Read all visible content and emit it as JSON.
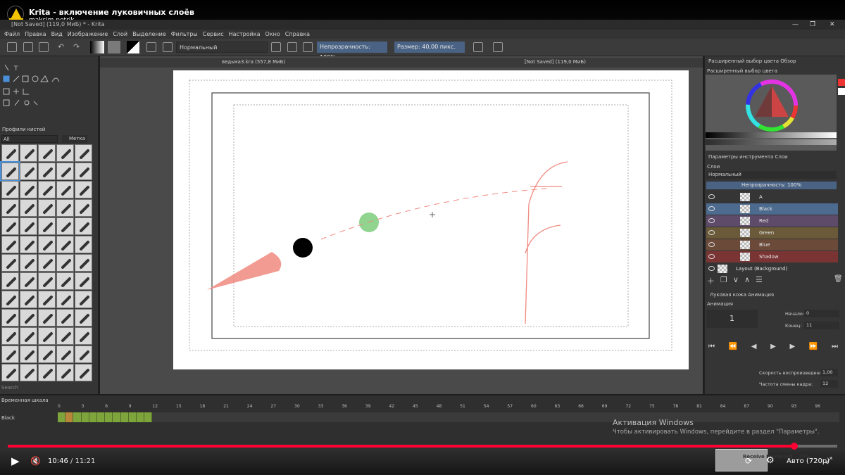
{
  "video": {
    "title": "Krita - включение луковичных слоёв",
    "channel": "maksim petrik",
    "time_current": "10:46",
    "time_total": "11:21",
    "progress": 0.948,
    "quality": "Авто (720p)",
    "end_card": "Receive Keyboard – 30%"
  },
  "krita": {
    "window_title": "[Not Saved]  (119,0 MиБ) * - Krita",
    "menu": [
      "Файл",
      "Правка",
      "Вид",
      "Изображение",
      "Слой",
      "Выделение",
      "Фильтры",
      "Сервис",
      "Настройка",
      "Окно",
      "Справка"
    ],
    "toolbar": {
      "blend_mode": "Нормальный",
      "opacity": "Непрозрачность: 100%",
      "size": "Размер: 40,00 пикс."
    },
    "tabs": [
      "ведьма3.kra (557,8 MиБ)",
      "[Not Saved]  (119,0 MиБ)"
    ],
    "brush_presets": {
      "title": "Профили кистей",
      "filter": "All",
      "tag": "Метка",
      "search": "Search"
    },
    "color": {
      "tabs": "Расширенный выбор цвета     Обзор",
      "title": "Расширенный выбор цвета"
    },
    "layers": {
      "tabs": "Параметры инструмента     Слои",
      "title": "Слои",
      "blend": "Нормальный",
      "opacity": "Непрозрачность: 100%",
      "items": [
        {
          "name": "A",
          "color": "#353535"
        },
        {
          "name": "Black",
          "color": "#4d6b8e"
        },
        {
          "name": "Red",
          "color": "#5e4b69"
        },
        {
          "name": "Green",
          "color": "#6b5a3a"
        },
        {
          "name": "Blue",
          "color": "#6b4a3a"
        },
        {
          "name": "Shadow",
          "color": "#7a3434"
        },
        {
          "name": "Layout (Background)",
          "color": "#353535"
        }
      ]
    },
    "animation": {
      "tabs": "Луковая кожа     Анимация",
      "title": "Анимация",
      "current_frame": "1",
      "start_label": "Начало:",
      "start": "0",
      "end_label": "Конец:",
      "end": "11",
      "speed_label": "Скорость воспроизведения:",
      "speed": "1,00",
      "fps_label": "Частота смены кадра:",
      "fps": "12"
    },
    "timeline": {
      "title": "Временная шкала",
      "layer": "Black",
      "ruler": [
        "0",
        "3",
        "6",
        "9",
        "12",
        "15",
        "18",
        "21",
        "24",
        "27",
        "30",
        "33",
        "36",
        "39",
        "42",
        "45",
        "48",
        "51",
        "54",
        "57",
        "60",
        "63",
        "66",
        "69",
        "72",
        "75",
        "78",
        "81",
        "84",
        "87",
        "90",
        "93",
        "96"
      ],
      "keyframes": 12
    }
  },
  "windows": {
    "activation_title": "Активация Windows",
    "activation_sub": "Чтобы активировать Windows, перейдите в раздел \"Параметры\"."
  },
  "colors": {
    "accent": "#ff0033",
    "selection": "#4a6384",
    "stroke_red": "#f08a80",
    "dot_green": "#7dcc7d"
  }
}
